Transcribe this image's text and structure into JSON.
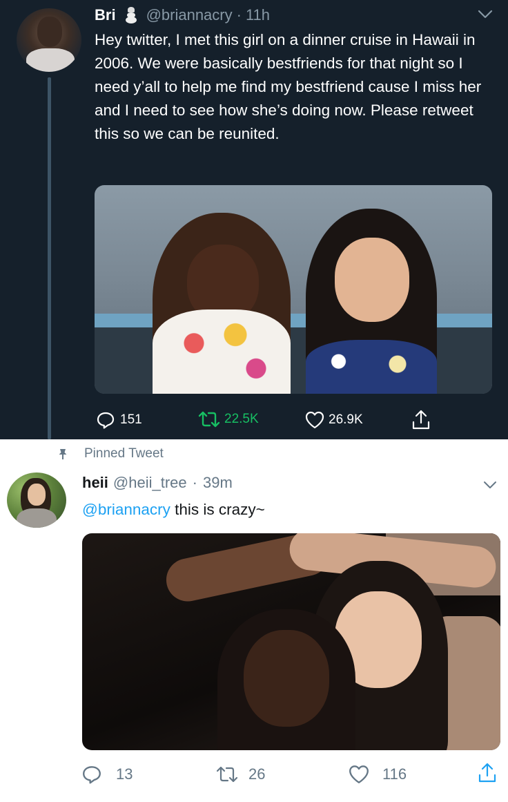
{
  "tweet1": {
    "name": "Bri",
    "handle": "@briannacry",
    "separator": "·",
    "time": "11h",
    "text": "Hey twitter, I met this girl on a dinner cruise in Hawaii in 2006. We were basically bestfriends for that night so I need y’all to help me find my bestfriend cause I miss her and I need to see how she’s doing now. Please retweet this so we can be reunited.",
    "replies": "151",
    "retweets": "22.5K",
    "likes": "26.9K",
    "colors": {
      "background": "#15202b",
      "text": "#ffffff",
      "muted": "#8899a6",
      "thread": "#3d5466"
    }
  },
  "tweet2": {
    "pinned_label": "Pinned Tweet",
    "name": "heii",
    "handle": "@heii_tree",
    "separator": "·",
    "time": "39m",
    "mention": "@briannacry",
    "text": " this is crazy~",
    "replies": "13",
    "retweets": "26",
    "likes": "116",
    "colors": {
      "background": "#ffffff",
      "text": "#14171a",
      "muted": "#657786",
      "link": "#1da1f2"
    }
  },
  "icons": [
    "reply-icon",
    "retweet-icon",
    "like-icon",
    "share-icon",
    "chevron-down-icon",
    "pin-icon",
    "snowman-emoji"
  ]
}
